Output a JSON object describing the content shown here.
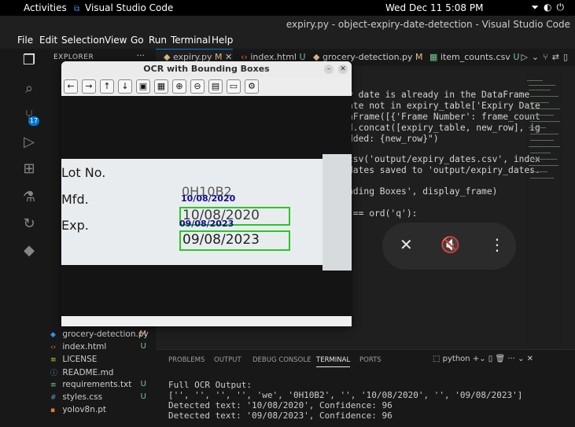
{
  "topbar": {
    "activities": "Activities",
    "app_name": "Visual Studio Code",
    "clock": "Wed Dec 11  5:08 PM"
  },
  "window_title": "expiry.py - object-expiry-date-detection - Visual Studio Code",
  "menu": [
    "File",
    "Edit",
    "Selection",
    "View",
    "Go",
    "Run",
    "Terminal",
    "Help"
  ],
  "sidebar": {
    "title": "EXPLORER",
    "files": [
      {
        "name": "grocery-detection.py",
        "status": "M",
        "icon": "python-icon"
      },
      {
        "name": "index.html",
        "status": "U",
        "icon": "html-icon"
      },
      {
        "name": "LICENSE",
        "status": "",
        "icon": "license-icon"
      },
      {
        "name": "README.md",
        "status": "",
        "icon": "markdown-icon"
      },
      {
        "name": "requirements.txt",
        "status": "U",
        "icon": "text-file-icon"
      },
      {
        "name": "styles.css",
        "status": "U",
        "icon": "css-icon"
      },
      {
        "name": "yolov8n.pt",
        "status": "",
        "icon": "file-icon"
      }
    ]
  },
  "tabs": [
    {
      "name": "expiry.py",
      "status": "M",
      "active": true
    },
    {
      "name": "index.html",
      "status": "U"
    },
    {
      "name": "grocery-detection.py",
      "status": "M"
    },
    {
      "name": "item_counts.csv",
      "status": "U"
    }
  ],
  "badge": "17",
  "code": [
    "y date is already in the DataFrame",
    "ate not in expiry_table['Expiry Date",
    "aFrame([{'Frame Number': frame_count",
    "d.concat([expiry_table, new_row], ig",
    "dded: {new_row}\")",
    "",
    "csv('output/expiry_dates.csv', index",
    "dates saved to 'output/expiry_dates.",
    "",
    "nding Boxes', display_frame)",
    "",
    " == ord('q'):"
  ],
  "ocr_window": {
    "title": "OCR with Bounding Boxes",
    "label_lines": [
      "Lot No.",
      "Mfd.",
      "Exp."
    ],
    "lot_code": "0H10B2",
    "mfd_date": "10/08/2020",
    "exp_date": "09/08/2023",
    "detections": [
      {
        "text": "10/08/2020",
        "confidence": 96
      },
      {
        "text": "09/08/2023",
        "confidence": 96
      }
    ]
  },
  "panel": {
    "tabs": [
      "PROBLEMS",
      "OUTPUT",
      "DEBUG CONSOLE",
      "TERMINAL",
      "PORTS"
    ],
    "active_tab": "TERMINAL",
    "shell": "python",
    "terminal_lines": [
      "Full OCR Output:",
      "['', '', '', '', 'we', '0H10B2', '', '10/08/2020', '', '09/08/2023']",
      "Detected text: '10/08/2020', Confidence: 96",
      "Detected text: '09/08/2023', Confidence: 96"
    ]
  }
}
